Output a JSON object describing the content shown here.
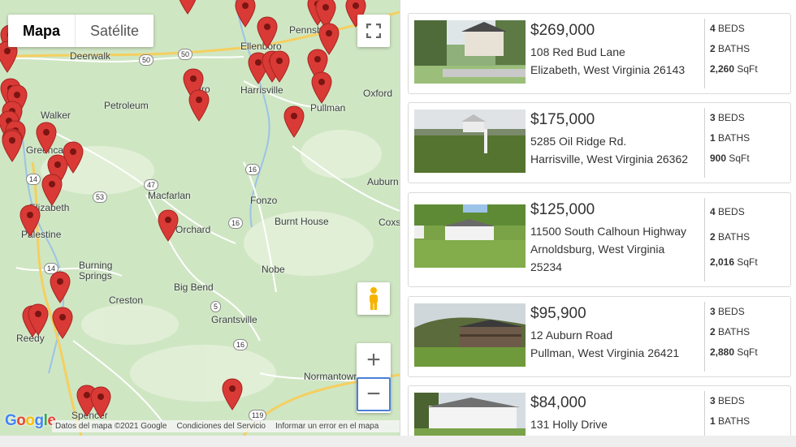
{
  "map": {
    "type_buttons": [
      "Mapa",
      "Satélite"
    ],
    "places": [
      "Deerwalk",
      "Ellenboro",
      "Pennsboro",
      "Harrisville",
      "Oxford",
      "Petroleum",
      "Cairo",
      "Pullman",
      "Walker",
      "Grantsville_label",
      "Macfarlan",
      "Fonzo",
      "Auburn",
      "Elizabeth",
      "Burnt House",
      "Palestine",
      "Orchard",
      "Coxs",
      "Burning",
      "Springs",
      "Nobe",
      "Big Bend",
      "Creston",
      "Grantsville",
      "Reedy",
      "Normantown",
      "Spencer"
    ],
    "place_labels": {
      "deerwalk": "Deerwalk",
      "ellenboro": "Ellenboro",
      "pennsboro": "Pennsboro",
      "harrisville": "Harrisville",
      "oxford": "Oxford",
      "petroleum": "Petroleum",
      "cairo": "Cairo",
      "pullman": "Pullman",
      "walker": "Walker",
      "greencastle": "Greencastle",
      "macfarlan": "Macfarlan",
      "fonzo": "Fonzo",
      "auburn": "Auburn",
      "elizabeth": "Elizabeth",
      "burnt_house": "Burnt House",
      "palestine": "Palestine",
      "orchard": "Orchard",
      "coxs": "Coxs",
      "burning": "Burning",
      "springs": "Springs",
      "nobe": "Nobe",
      "big_bend": "Big Bend",
      "creston": "Creston",
      "grantsville": "Grantsville",
      "reedy": "Reedy",
      "normantown": "Normantown",
      "spencer": "Spencer"
    },
    "route_shields": {
      "r50a": "50",
      "r50b": "50",
      "r47": "47",
      "r53": "53",
      "r16a": "16",
      "r16b": "16",
      "r16c": "16",
      "r5": "5",
      "r14a": "14",
      "r14b": "14",
      "r119": "119"
    },
    "google_logo": "Google",
    "attribution": [
      "Datos del mapa ©2021 Google",
      "Condiciones del Servicio",
      "Informar un error en el mapa"
    ],
    "zoom_in": "+",
    "zoom_out": "−",
    "pin_color": "#d93a36"
  },
  "listings": [
    {
      "price": "$269,000",
      "street": "108 Red Bud Lane",
      "city": "Elizabeth, West Virginia 26143",
      "beds": "4",
      "baths": "2",
      "sqft": "2,260",
      "beds_label": "BEDS",
      "baths_label": "BATHS",
      "sqft_label": "SqFt"
    },
    {
      "price": "$175,000",
      "street": "5285 Oil Ridge Rd.",
      "city": "Harrisville, West Virginia 26362",
      "beds": "3",
      "baths": "1",
      "sqft": "900",
      "beds_label": "BEDS",
      "baths_label": "BATHS",
      "sqft_label": "SqFt"
    },
    {
      "price": "$125,000",
      "street": "11500 South Calhoun Highway",
      "city": "Arnoldsburg, West Virginia",
      "zip": "25234",
      "beds": "4",
      "baths": "2",
      "sqft": "2,016",
      "beds_label": "BEDS",
      "baths_label": "BATHS",
      "sqft_label": "SqFt"
    },
    {
      "price": "$95,900",
      "street": "12 Auburn Road",
      "city": "Pullman, West Virginia 26421",
      "beds": "3",
      "baths": "2",
      "sqft": "2,880",
      "beds_label": "BEDS",
      "baths_label": "BATHS",
      "sqft_label": "SqFt"
    },
    {
      "price": "$84,000",
      "street": "131 Holly Drive",
      "beds": "3",
      "baths": "1",
      "beds_label": "BEDS",
      "baths_label": "BATHS"
    }
  ]
}
